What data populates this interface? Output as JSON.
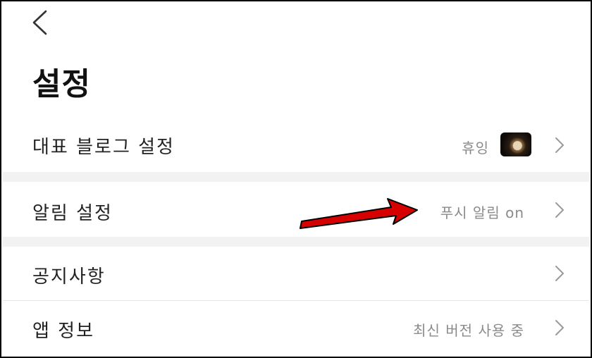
{
  "header": {
    "back_icon": "chevron-left-icon",
    "title": "설정"
  },
  "settings": {
    "blog": {
      "label": "대표 블로그 설정",
      "value": "휴잉",
      "thumbnail_icon": "blog-thumbnail-icon",
      "chevron_icon": "chevron-right-icon"
    },
    "notifications": {
      "label": "알림 설정",
      "value": "푸시 알림 on",
      "chevron_icon": "chevron-right-icon"
    },
    "notices": {
      "label": "공지사항",
      "chevron_icon": "chevron-right-icon"
    },
    "app_info": {
      "label": "앱 정보",
      "value": "최신 버전 사용 중",
      "chevron_icon": "chevron-right-icon"
    }
  },
  "annotation": {
    "arrow_icon": "red-arrow-icon",
    "arrow_color": "#d60000"
  },
  "colors": {
    "label_text": "#222222",
    "value_text": "#8a8a8a",
    "section_gap": "#f2f2f2"
  }
}
